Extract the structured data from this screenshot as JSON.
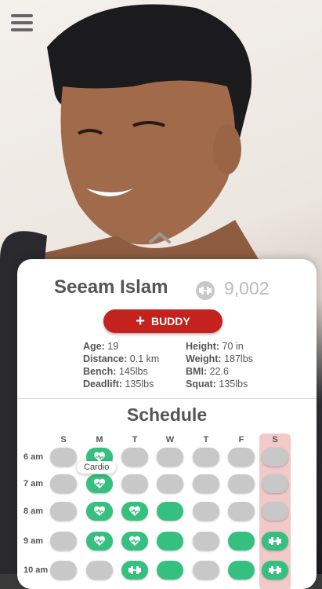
{
  "profile": {
    "name": "Seeam Islam",
    "points": "9,002"
  },
  "buddy_button": "BUDDY",
  "stats_left": [
    {
      "label": "Age:",
      "value": "19"
    },
    {
      "label": "Distance:",
      "value": "0.1 km"
    },
    {
      "label": "Bench:",
      "value": "145lbs"
    },
    {
      "label": "Deadlift:",
      "value": "135lbs"
    }
  ],
  "stats_right": [
    {
      "label": "Height:",
      "value": "70 in"
    },
    {
      "label": "Weight:",
      "value": "187lbs"
    },
    {
      "label": "BMI:",
      "value": "22.6"
    },
    {
      "label": "Squat:",
      "value": "135lbs"
    }
  ],
  "schedule": {
    "title": "Schedule",
    "days": [
      "S",
      "M",
      "T",
      "W",
      "T",
      "F",
      "S"
    ],
    "times": [
      "6 am",
      "7 am",
      "8 am",
      "9 am",
      "10 am"
    ],
    "tooltip": "Cardio",
    "grid": [
      [
        "off",
        "heart",
        "off",
        "off",
        "off",
        "off",
        "off"
      ],
      [
        "off",
        "heart",
        "off",
        "off",
        "off",
        "off",
        "off"
      ],
      [
        "off",
        "heart",
        "heart",
        "on",
        "off",
        "off",
        "off"
      ],
      [
        "off",
        "heart",
        "heart",
        "on",
        "off",
        "on",
        "dumbbell"
      ],
      [
        "off",
        "off",
        "dumbbell",
        "on",
        "off",
        "on",
        "dumbbell"
      ]
    ]
  },
  "colors": {
    "accent": "#c4221e",
    "active": "#35c07f",
    "weekend": "#f1c9c9"
  }
}
